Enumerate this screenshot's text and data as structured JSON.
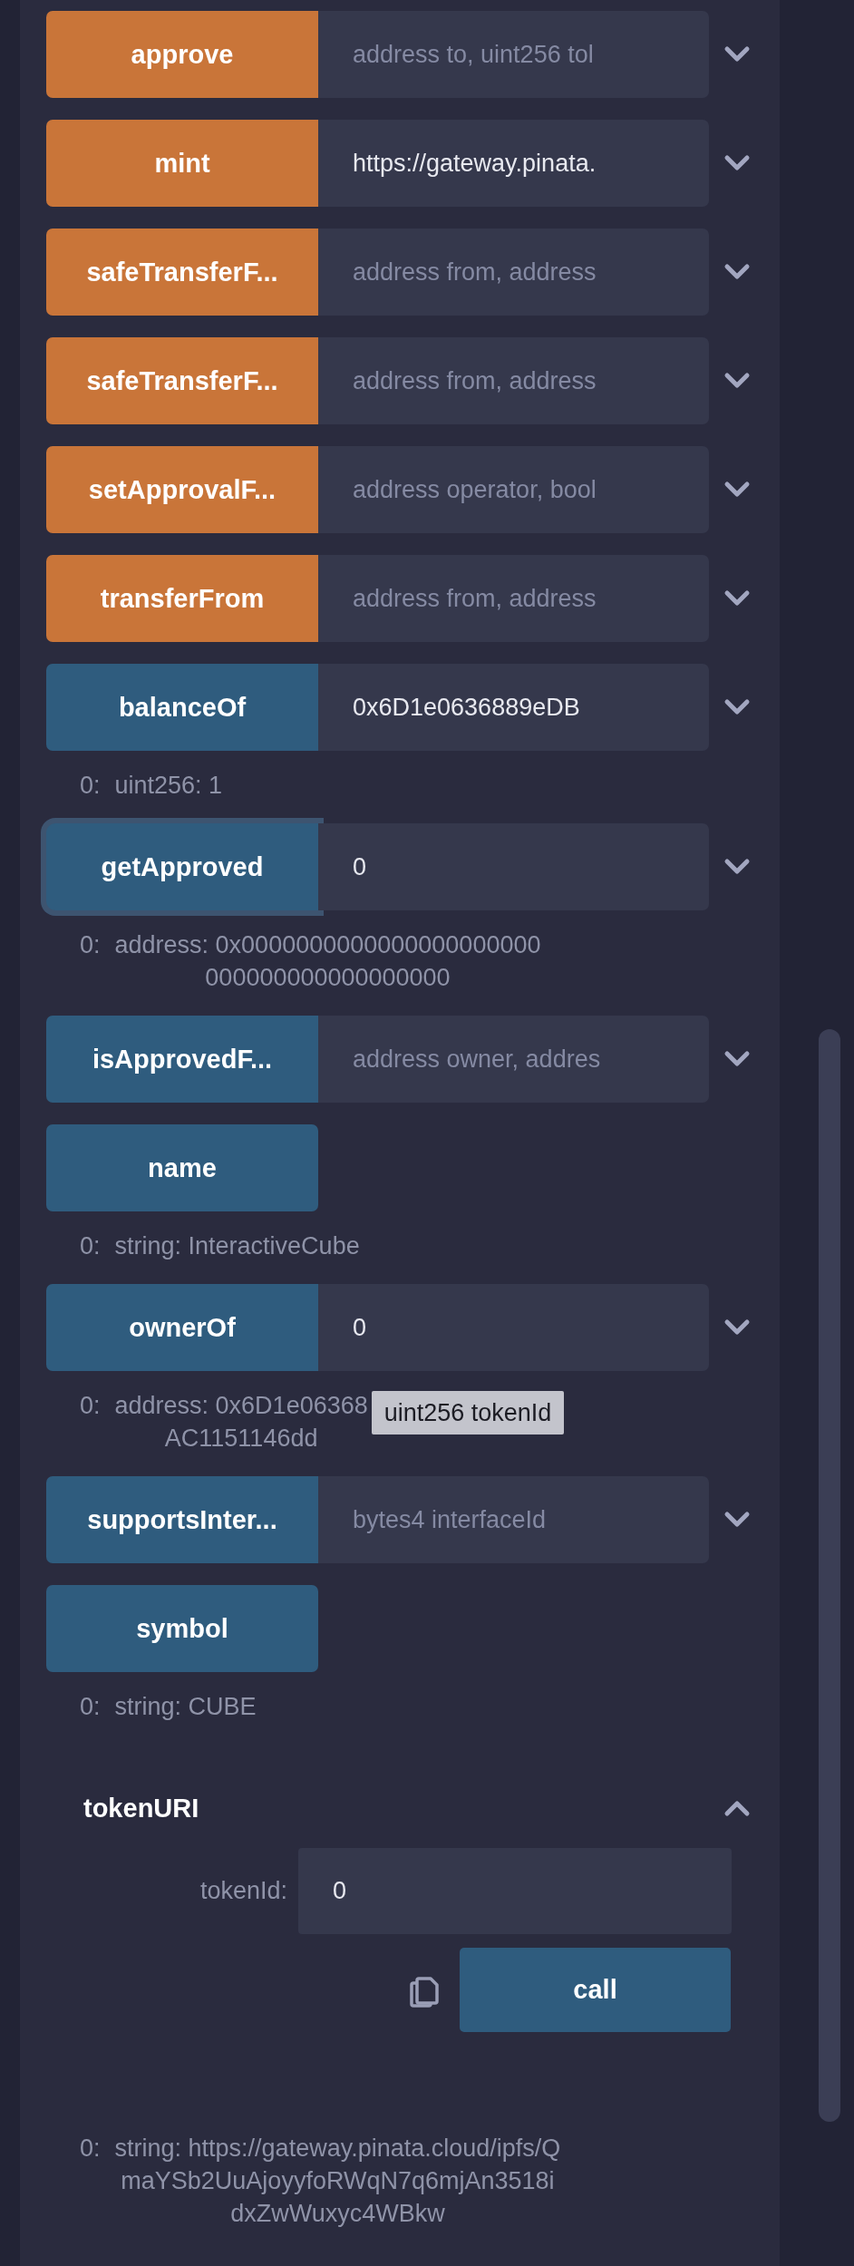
{
  "functions": [
    {
      "name": "approve",
      "kind": "transact",
      "input": {
        "placeholder": "address to, uint256 tol"
      },
      "focused": false
    },
    {
      "name": "mint",
      "kind": "transact",
      "input": {
        "value": "https://gateway.pinata."
      },
      "focused": false
    },
    {
      "name": "safeTransferF...",
      "kind": "transact",
      "input": {
        "placeholder": "address from, address"
      },
      "focused": false
    },
    {
      "name": "safeTransferF...",
      "kind": "transact",
      "input": {
        "placeholder": "address from, address"
      },
      "focused": false
    },
    {
      "name": "setApprovalF...",
      "kind": "transact",
      "input": {
        "placeholder": "address operator, bool"
      },
      "focused": false
    },
    {
      "name": "transferFrom",
      "kind": "transact",
      "input": {
        "placeholder": "address from, address"
      },
      "focused": false
    },
    {
      "name": "balanceOf",
      "kind": "call",
      "input": {
        "value": "0x6D1e0636889eDB"
      },
      "focused": false,
      "result": {
        "index": "0:",
        "lines": [
          "uint256: 1"
        ]
      }
    },
    {
      "name": "getApproved",
      "kind": "call",
      "input": {
        "value": "0"
      },
      "focused": true,
      "result": {
        "index": "0:",
        "lines": [
          "address: 0x0000000000000000000000",
          "000000000000000000"
        ]
      }
    },
    {
      "name": "isApprovedF...",
      "kind": "call",
      "input": {
        "placeholder": "address owner, addres"
      },
      "focused": false
    },
    {
      "name": "name",
      "kind": "call",
      "focused": false,
      "result": {
        "index": "0:",
        "lines": [
          "string: InteractiveCube"
        ]
      }
    },
    {
      "name": "ownerOf",
      "kind": "call",
      "input": {
        "value": "0"
      },
      "focused": false,
      "result": {
        "index": "0:",
        "lines": [
          "address: 0x6D1e06368",
          "AC1151146dd"
        ],
        "tooltip": "uint256 tokenId"
      }
    },
    {
      "name": "supportsInter...",
      "kind": "call",
      "input": {
        "placeholder": "bytes4 interfaceId"
      },
      "focused": false
    },
    {
      "name": "symbol",
      "kind": "call",
      "focused": false,
      "result": {
        "index": "0:",
        "lines": [
          "string: CUBE"
        ]
      }
    }
  ],
  "expanded_function": {
    "name": "tokenURI",
    "expanded": true,
    "param_label": "tokenId:",
    "param_value": "0",
    "button": "call",
    "result": {
      "index": "0:",
      "lines": [
        "string: https://gateway.pinata.cloud/ipfs/Q",
        "maYSb2UuAjoyyfoRWqN7q6mjAn3518i",
        "dxZwWuxyc4WBkw"
      ]
    }
  }
}
